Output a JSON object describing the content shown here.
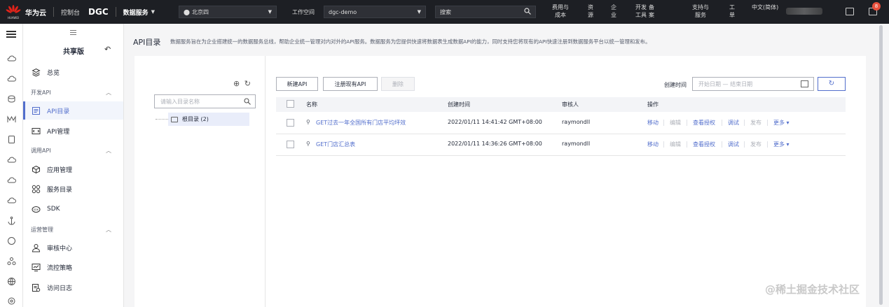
{
  "topbar": {
    "brand": "华为云",
    "logo_text": "HUAWEI",
    "console": "控制台",
    "product": "DGC",
    "service": "数据服务",
    "region": "北京四",
    "workspace_label": "工作空间",
    "workspace": "dgc-demo",
    "search_placeholder": "搜索",
    "nav": [
      "费用与成本",
      "资源",
      "企业",
      "开发工具",
      "备案",
      "支持与服务",
      "工单",
      "中文(简体)"
    ],
    "notification_count": "8"
  },
  "menu": {
    "title": "共享版",
    "overview": "总览",
    "group_dev": "开发API",
    "api_catalog": "API目录",
    "api_manage": "API管理",
    "group_call": "调用API",
    "app_manage": "应用管理",
    "service_catalog": "服务目录",
    "sdk": "SDK",
    "group_ops": "运营管理",
    "review_center": "审核中心",
    "flow_policy": "流控策略",
    "access_log": "访问日志"
  },
  "page": {
    "title": "API目录",
    "description": "数据服务旨在为企业搭建统一的数据服务总线，帮助企业统一管理对内对外的API服务。数据服务为您提供快速将数据表生成数据API的能力，同时支持您将现有的API快速注册到数据服务平台以统一管理和发布。"
  },
  "tree": {
    "search_placeholder": "请输入目录名称",
    "root": "根目录 (2)"
  },
  "toolbar": {
    "new_api": "新建API",
    "register_api": "注册现有API",
    "delete": "删除",
    "date_label": "创建时间",
    "date_placeholder": "开始日期 — 结束日期"
  },
  "table": {
    "headers": {
      "name": "名称",
      "created": "创建时间",
      "reviewer": "审核人",
      "actions": "操作"
    },
    "rows": [
      {
        "name": "GET过去一年全国所有门店平均坪效",
        "created": "2022/01/11 14:41:42 GMT+08:00",
        "reviewer": "raymondll"
      },
      {
        "name": "GET门店汇总表",
        "created": "2022/01/11 14:36:26 GMT+08:00",
        "reviewer": "raymondll"
      }
    ],
    "actions": {
      "move": "移动",
      "edit": "编辑",
      "view_auth": "查看授权",
      "debug": "调试",
      "publish": "发布",
      "more": "更多"
    }
  },
  "watermark": "@稀土掘金技术社区",
  "colors": {
    "accent": "#526ecc",
    "topbar": "#1d1f24",
    "badge": "#e84f3c"
  }
}
